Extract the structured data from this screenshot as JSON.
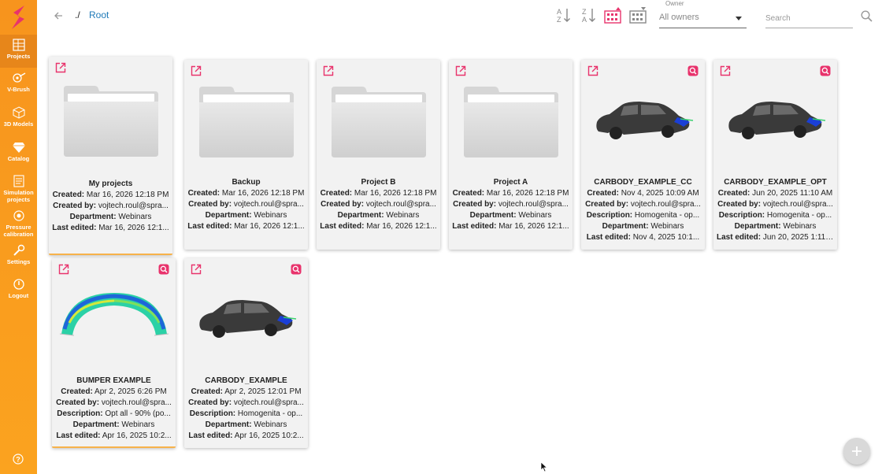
{
  "sidebar": {
    "items": [
      {
        "label": "Projects",
        "icon": "projects-icon",
        "active": true
      },
      {
        "label": "V-Brush",
        "icon": "brush-icon"
      },
      {
        "label": "3D Models",
        "icon": "cube-icon"
      },
      {
        "label": "Catalog",
        "icon": "diamond-icon"
      },
      {
        "label": "Simulation projects",
        "icon": "simulation-icon"
      },
      {
        "label": "Pressure calibration",
        "icon": "pressure-icon"
      },
      {
        "label": "Settings",
        "icon": "wrench-icon"
      },
      {
        "label": "Logout",
        "icon": "power-icon"
      }
    ]
  },
  "breadcrumb": {
    "prefix": "./",
    "root": "Root"
  },
  "owner": {
    "label": "Owner",
    "value": "All owners"
  },
  "search": {
    "placeholder": "Search"
  },
  "colors": {
    "accent": "#f7941d",
    "pink": "#e8336c",
    "link": "#1f7ab8"
  },
  "cards": [
    {
      "title": "My projects",
      "type": "folder",
      "rows": [
        {
          "k": "Created:",
          "v": "Mar 16, 2026 12:18 PM"
        },
        {
          "k": "Created by:",
          "v": "vojtech.roul@spra..."
        },
        {
          "k": "Department:",
          "v": "Webinars"
        },
        {
          "k": "Last edited:",
          "v": "Mar 16, 2026 12:1..."
        }
      ]
    },
    {
      "title": "Backup",
      "type": "folder",
      "rows": [
        {
          "k": "Created:",
          "v": "Mar 16, 2026 12:18 PM"
        },
        {
          "k": "Created by:",
          "v": "vojtech.roul@spra..."
        },
        {
          "k": "Department:",
          "v": "Webinars"
        },
        {
          "k": "Last edited:",
          "v": "Mar 16, 2026 12:1..."
        }
      ]
    },
    {
      "title": "Project B",
      "type": "folder",
      "rows": [
        {
          "k": "Created:",
          "v": "Mar 16, 2026 12:18 PM"
        },
        {
          "k": "Created by:",
          "v": "vojtech.roul@spra..."
        },
        {
          "k": "Department:",
          "v": "Webinars"
        },
        {
          "k": "Last edited:",
          "v": "Mar 16, 2026 12:1..."
        }
      ]
    },
    {
      "title": "Project A",
      "type": "folder",
      "rows": [
        {
          "k": "Created:",
          "v": "Mar 16, 2026 12:18 PM"
        },
        {
          "k": "Created by:",
          "v": "vojtech.roul@spra..."
        },
        {
          "k": "Department:",
          "v": "Webinars"
        },
        {
          "k": "Last edited:",
          "v": "Mar 16, 2026 12:1..."
        }
      ]
    },
    {
      "title": "CARBODY_EXAMPLE_CC",
      "type": "car",
      "rows": [
        {
          "k": "Created:",
          "v": "Nov 4, 2025 10:09 AM"
        },
        {
          "k": "Created by:",
          "v": "vojtech.roul@spra..."
        },
        {
          "k": "Description:",
          "v": "Homogenita - op..."
        },
        {
          "k": "Department:",
          "v": "Webinars"
        },
        {
          "k": "Last edited:",
          "v": "Nov 4, 2025 10:1..."
        }
      ]
    },
    {
      "title": "CARBODY_EXAMPLE_OPT",
      "type": "car",
      "rows": [
        {
          "k": "Created:",
          "v": "Jun 20, 2025 11:10 AM"
        },
        {
          "k": "Created by:",
          "v": "vojtech.roul@spra..."
        },
        {
          "k": "Description:",
          "v": "Homogenita - op..."
        },
        {
          "k": "Department:",
          "v": "Webinars"
        },
        {
          "k": "Last edited:",
          "v": "Jun 20, 2025 1:11 ..."
        }
      ]
    },
    {
      "title": "BUMPER EXAMPLE",
      "type": "bumper",
      "rows": [
        {
          "k": "Created:",
          "v": "Apr 2, 2025 6:26 PM"
        },
        {
          "k": "Created by:",
          "v": "vojtech.roul@spra..."
        },
        {
          "k": "Description:",
          "v": "Opt all - 90% (po..."
        },
        {
          "k": "Department:",
          "v": "Webinars"
        },
        {
          "k": "Last edited:",
          "v": "Apr 16, 2025 10:2..."
        }
      ]
    },
    {
      "title": "CARBODY_EXAMPLE",
      "type": "car",
      "rows": [
        {
          "k": "Created:",
          "v": "Apr 2, 2025 12:01 PM"
        },
        {
          "k": "Created by:",
          "v": "vojtech.roul@spra..."
        },
        {
          "k": "Description:",
          "v": "Homogenita - op..."
        },
        {
          "k": "Department:",
          "v": "Webinars"
        },
        {
          "k": "Last edited:",
          "v": "Apr 16, 2025 10:2..."
        }
      ]
    }
  ]
}
